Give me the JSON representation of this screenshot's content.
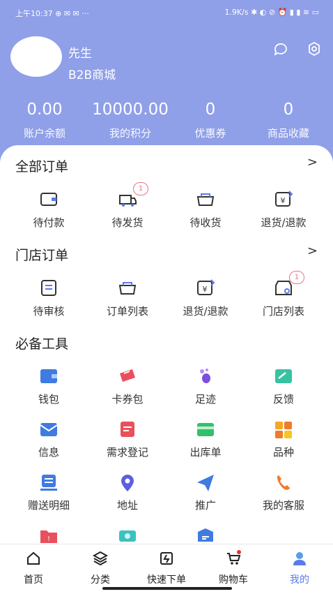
{
  "status_bar": {
    "left": "上午10:37  ⊕  ✉  ✉  ···",
    "right": "1.9K/s ✱ ◐ ⊘ ⏰ ▮ ▮ ≋ ▭"
  },
  "user": {
    "name": "先生",
    "shop": "B2B商城"
  },
  "stats": [
    {
      "value": "0.00",
      "label": "账户余额"
    },
    {
      "value": "10000.00",
      "label": "我的积分"
    },
    {
      "value": "0",
      "label": "优惠券"
    },
    {
      "value": "0",
      "label": "商品收藏"
    }
  ],
  "orders": {
    "title": "全部订单",
    "chevron": ">",
    "items": [
      {
        "label": "待付款",
        "icon": "wallet-icon"
      },
      {
        "label": "待发货",
        "icon": "truck-icon",
        "badge": "1"
      },
      {
        "label": "待收货",
        "icon": "basket-icon"
      },
      {
        "label": "退货/退款",
        "icon": "refund-icon"
      }
    ]
  },
  "store_orders": {
    "title": "门店订单",
    "chevron": ">",
    "items": [
      {
        "label": "待审核",
        "icon": "document-icon"
      },
      {
        "label": "订单列表",
        "icon": "basket-icon"
      },
      {
        "label": "退货/退款",
        "icon": "refund-icon"
      },
      {
        "label": "门店列表",
        "icon": "store-icon",
        "badge": "1"
      }
    ]
  },
  "tools": {
    "title": "必备工具",
    "items": [
      {
        "label": "钱包",
        "icon": "wallet-icon",
        "color": "#3f7be0"
      },
      {
        "label": "卡券包",
        "icon": "ticket-icon",
        "color": "#e8505b"
      },
      {
        "label": "足迹",
        "icon": "footprint-icon",
        "color": "#7b4fe0"
      },
      {
        "label": "反馈",
        "icon": "feedback-icon",
        "color": "#38c2a2"
      },
      {
        "label": "信息",
        "icon": "mail-icon",
        "color": "#3f7be0"
      },
      {
        "label": "需求登记",
        "icon": "form-icon",
        "color": "#e8505b"
      },
      {
        "label": "出库单",
        "icon": "card-icon",
        "color": "#33c06a"
      },
      {
        "label": "品种",
        "icon": "grid-icon",
        "color": "#f5a623"
      },
      {
        "label": "赠送明细",
        "icon": "list-icon",
        "color": "#3f7be0"
      },
      {
        "label": "地址",
        "icon": "location-icon",
        "color": "#5b5fe0"
      },
      {
        "label": "推广",
        "icon": "send-icon",
        "color": "#3f7be0"
      },
      {
        "label": "我的客服",
        "icon": "phone-icon",
        "color": "#f07b2a"
      },
      {
        "label": "",
        "icon": "warning-folder-icon",
        "color": "#e8505b"
      },
      {
        "label": "",
        "icon": "cash-icon",
        "color": "#38c2c2"
      },
      {
        "label": "",
        "icon": "box-icon",
        "color": "#3f7be0"
      }
    ]
  },
  "tabs": [
    {
      "label": "首页",
      "icon": "home-icon"
    },
    {
      "label": "分类",
      "icon": "layers-icon"
    },
    {
      "label": "快速下单",
      "icon": "quick-order-icon"
    },
    {
      "label": "购物车",
      "icon": "cart-icon"
    },
    {
      "label": "我的",
      "icon": "user-icon",
      "active": true
    }
  ],
  "colors": {
    "header": "#8f9fe8",
    "badge": "#e8747f",
    "active_tab": "#5b7be8"
  }
}
